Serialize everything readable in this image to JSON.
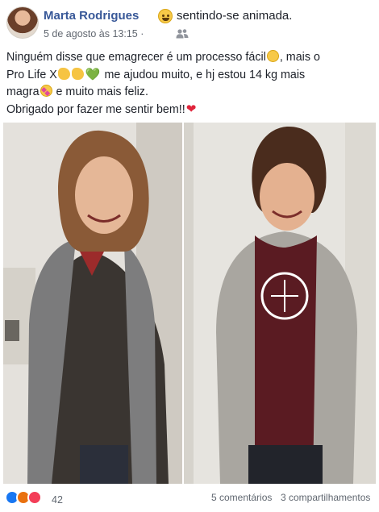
{
  "post": {
    "author": "Marta Rodrigues",
    "feeling": "sentindo-se animada.",
    "timestamp": "5 de agosto às 13:15 ·",
    "audience_icon": "friends-icon",
    "text_lines": [
      "Ninguém disse que emagrecer é um processo fácil",
      ", mais o",
      "Pro Life X",
      " me ajudou muito, e hj estou 14 kg mais",
      "magra",
      " e muito mais feliz.",
      "Obrigado por fazer me sentir bem!!"
    ],
    "emojis": {
      "feeling": "grinning-face-icon",
      "sad": "disappointed-face-icon",
      "clap": "clapping-hands-icon",
      "green_heart": "💚",
      "star_eyes": "star-struck-face-icon",
      "red_heart": "❤"
    }
  },
  "photos": {
    "before": "before-photo",
    "after": "after-photo"
  },
  "footer": {
    "reaction_icons": [
      "like-icon",
      "angry-icon",
      "love-icon"
    ],
    "reaction_count": "42",
    "comments": "5 comentários",
    "shares": "3 compartilhamentos"
  },
  "colors": {
    "name": "#385898",
    "text": "#1d2129",
    "meta": "#616770",
    "like": "#1877f2",
    "angry": "#e9710f",
    "love": "#f33e58"
  }
}
